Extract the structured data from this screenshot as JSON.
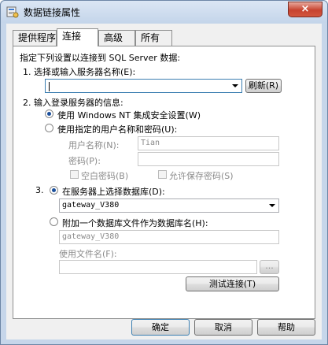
{
  "window": {
    "title": "数据链接属性",
    "close": "×"
  },
  "tabs": [
    "提供程序",
    "连接",
    "高级",
    "所有"
  ],
  "intro": "指定下列设置以连接到 SQL Server 数据:",
  "step1": {
    "label": "1. 选择或输入服务器名称(E):",
    "value": "",
    "refresh": "刷新(R)"
  },
  "step2": {
    "label": "2. 输入登录服务器的信息:",
    "option_nt": "使用 Windows NT 集成安全设置(W)",
    "option_user": "使用指定的用户名称和密码(U):",
    "username_label": "用户名称(N):",
    "username_value": "Tian",
    "password_label": "密码(P):",
    "password_value": "",
    "blank_password": "空白密码(B)",
    "allow_save": "允许保存密码(S)"
  },
  "step3": {
    "label_prefix": "3.",
    "option_select": "在服务器上选择数据库(D):",
    "database_value": "gateway_V380",
    "option_attach": "附加一个数据库文件作为数据库名(H):",
    "attach_value": "gateway_V380",
    "filename_label": "使用文件名(F):",
    "filename_value": "",
    "browse": "..."
  },
  "test_button": "测试连接(T)",
  "footer": {
    "ok": "确定",
    "cancel": "取消",
    "help": "帮助"
  }
}
